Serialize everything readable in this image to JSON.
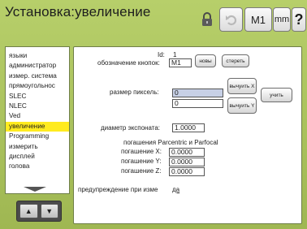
{
  "header": {
    "title": "Установка:увеличение",
    "buttons": {
      "undo": "undo",
      "m1": "M1",
      "mm": "mm",
      "help": "?"
    }
  },
  "sidebar": {
    "items": [
      {
        "label": "языки",
        "active": false
      },
      {
        "label": "администратор",
        "active": false
      },
      {
        "label": "измер. система",
        "active": false
      },
      {
        "label": "прямоугольнос",
        "active": false
      },
      {
        "label": "SLEC",
        "active": false
      },
      {
        "label": "NLEC",
        "active": false
      },
      {
        "label": "Ved",
        "active": false
      },
      {
        "label": "увеличение",
        "active": true
      },
      {
        "label": "Programming",
        "active": false
      },
      {
        "label": "измерить",
        "active": false
      },
      {
        "label": "дисплей",
        "active": false
      },
      {
        "label": "голова",
        "active": false
      }
    ],
    "scroll_up": "▲",
    "scroll_down": "▼"
  },
  "panel": {
    "id_label": "Id:",
    "id_value": "1",
    "button_name_label": "обозначение кнопок:",
    "button_name_value": "M1",
    "new_btn": "новы",
    "delete_btn": "стереть",
    "pixel_size_label": "размер пиксель:",
    "pixel_x_value": "0",
    "pixel_y_value": "0",
    "calc_x_btn": "вычуить X",
    "calc_y_btn": "вычуить Y",
    "learn_btn": "учить",
    "diameter_label": "диаметр экспоната:",
    "diameter_value": "1.0000",
    "parcentric_title": "погашения Parcentric и Parfocal",
    "offset_x_label": "погашение X:",
    "offset_x_value": "0.0000",
    "offset_y_label": "погашение Y:",
    "offset_y_value": "0.0000",
    "offset_z_label": "погашение Z:",
    "offset_z_value": "0.0000",
    "warning_label": "предупреждение при изме",
    "warning_value": "да"
  }
}
